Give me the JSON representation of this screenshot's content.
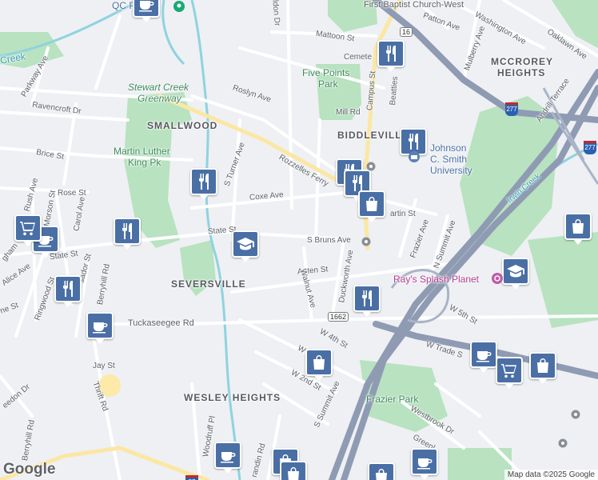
{
  "map": {
    "neighborhoods": [
      "SMALLWOOD",
      "BIDDLEVILLE",
      "SEVERSVILLE",
      "WESLEY HEIGHTS",
      "MCCROREY",
      "HEIGHTS"
    ],
    "parks": [
      "Stewart Creek",
      "Greenway",
      "Five Points",
      "Park",
      "Martin Luther",
      "King Pk",
      "Frazier Park"
    ],
    "water": [
      "Creek",
      "Irwin Creek"
    ],
    "places": [
      "QC Pi",
      "First Baptist Church-West",
      "Johnson",
      "C. Smith",
      "University",
      "Ray's Splash Planet"
    ],
    "streets": {
      "mattoon": "Mattoon St",
      "patton": "Patton Ave",
      "washington": "Washington Ave",
      "oaklawn": "Oaklawn Ave",
      "mulberry": "Mulberry Ave",
      "cemetery": "Cemete",
      "roslyn": "Roslyn Ave",
      "campus": "Campus St",
      "beatties": "Beatties",
      "mill": "Mill Rd",
      "andrill": "Andrill Terrace",
      "parkway": "Parkway Ave",
      "ravencroft": "Ravencroft Dr",
      "brice": "Brice St",
      "rush": "Rush Ave",
      "rose": "Rose St",
      "turner": "S Turner Ave",
      "rozzelles": "Rozzelles Ferry",
      "coxe": "Coxe Ave",
      "martin": "artin St",
      "morson": "Morson St",
      "carol": "Carol Ave",
      "state1": "State St",
      "state2": "State St",
      "sbruns": "S Bruns Ave",
      "frazier": "Frazier Ave",
      "nsummit": "N Summit Ave",
      "alice": "Alice Ave",
      "ambassador": "sador St",
      "ingham": "gham",
      "berryhill1": "Berryhill Rd",
      "ringwood": "Ringwood St",
      "nest": "ne St",
      "auten": "Auten St",
      "walnut": "Walnut Ave",
      "duckworth": "Duckworth Ave",
      "tuckaseegee": "Tuckaseegee Rd",
      "w5th": "W 5th St",
      "w4th": "W 4th St",
      "wtrade": "W Trade S",
      "w2nd": "W 2nd St",
      "w1stext": "W 1st Ext",
      "ssummit": "S Summit Ave",
      "jay": "Jay St",
      "thrift": "Thrift Rd",
      "berryhill2": "Berryhill Rd",
      "woodruff": "Woodruff Pl",
      "westbrook": "Westbrook Dr",
      "greenl": "Greenl",
      "reedon": "eedon Dr",
      "randin": "randin Rd",
      "eldon": "eldon Dr"
    },
    "shields": [
      "16",
      "1662",
      "277",
      "277",
      "27"
    ],
    "attribution": "Map data ©2025 Google",
    "logo": "Google",
    "colors": {
      "background": "#eef0f3",
      "park": "#b8e2c0",
      "water": "#8fd3df",
      "highway": "#8f9bb3",
      "pin": "#4a6fa5"
    }
  }
}
